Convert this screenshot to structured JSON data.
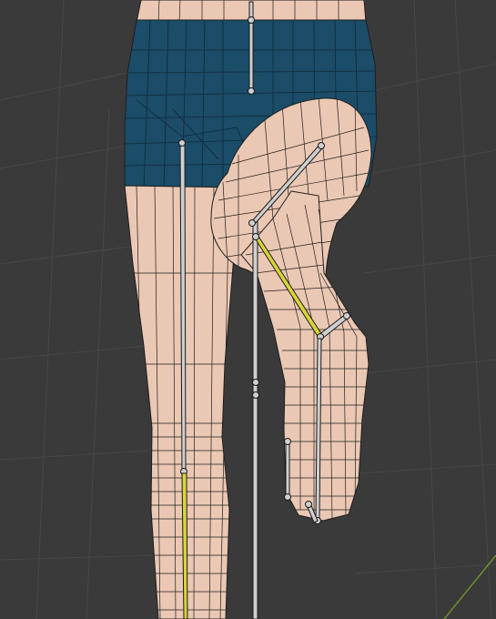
{
  "viewport": {
    "kind": "3d-viewport",
    "mode": "pose",
    "background_color": "#3a3a3a",
    "grid_line_color": "#4a4a4a",
    "axis_line_color": "#6c8f2e"
  },
  "mesh": {
    "skin_color": "#ebc8b4",
    "shorts_color": "#1b4c68",
    "wire_color": "#1e1e1e"
  },
  "armature": {
    "bone_color": "#cfcfcf",
    "bone_outline_color": "#1a1a1a",
    "active_bone_color": "#d8d43a"
  }
}
